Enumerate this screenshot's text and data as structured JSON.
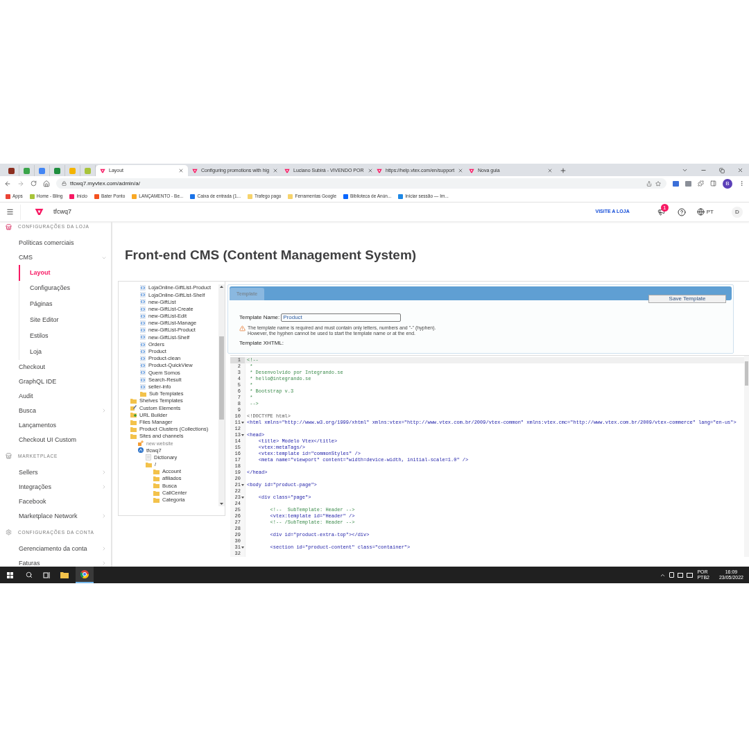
{
  "browser": {
    "pinned_tabs": [
      {
        "color": "#8b2e1f"
      },
      {
        "color": "#3aa54a"
      },
      {
        "color": "#4285f4"
      },
      {
        "color": "#1e8e3e"
      },
      {
        "color": "#f4b400"
      },
      {
        "color": "#a8c43a"
      }
    ],
    "tabs": [
      {
        "title": "Layout",
        "selected": true
      },
      {
        "title": "Configuring promotions with hig",
        "selected": false
      },
      {
        "title": "Luciano Subirá - VIVENDO POR",
        "selected": false
      },
      {
        "title": "https://help.vtex.com/en/support",
        "selected": false
      },
      {
        "title": "Nova guia",
        "selected": false
      }
    ],
    "url": "tfcwq7.myvtex.com/admin/a/",
    "profile": "B",
    "bookmarks": [
      {
        "label": "Apps",
        "color": "#ea4335"
      },
      {
        "label": "Home - Bling",
        "color": "#a8c43a"
      },
      {
        "label": "Início",
        "color": "#f71963"
      },
      {
        "label": "Bater Ponto",
        "color": "#f4511e"
      },
      {
        "label": "LANÇAMENTO - Be...",
        "color": "#f9a825"
      },
      {
        "label": "Caixa de entrada (1...",
        "color": "#1a73e8"
      },
      {
        "label": "Trafego pago",
        "color": "#f6d36b"
      },
      {
        "label": "Ferramentas Google",
        "color": "#f6d36b"
      },
      {
        "label": "Biblioteca de Anún...",
        "color": "#0866ff"
      },
      {
        "label": "Iniciar sessão — Im...",
        "color": "#1e88e5"
      }
    ]
  },
  "header": {
    "account": "tfcwq7",
    "visit_store": "VISITE A LOJA",
    "notifications": "1",
    "language": "PT",
    "avatar": "D"
  },
  "sidebar": [
    {
      "kind": "section",
      "label": "CONFIGURAÇÕES DA LOJA"
    },
    {
      "kind": "plain",
      "label": "Políticas comerciais"
    },
    {
      "kind": "expanded",
      "label": "CMS",
      "children": [
        {
          "label": "Layout",
          "selected": true
        },
        {
          "label": "Configurações",
          "selected": false
        },
        {
          "label": "Páginas",
          "selected": false
        },
        {
          "label": "Site Editor",
          "selected": false
        },
        {
          "label": "Estilos",
          "selected": false
        },
        {
          "label": "Loja",
          "selected": false
        }
      ]
    },
    {
      "kind": "plain",
      "label": "Checkout"
    },
    {
      "kind": "plain",
      "label": "GraphQL IDE"
    },
    {
      "kind": "plain",
      "label": "Audit"
    },
    {
      "kind": "collapsed",
      "label": "Busca"
    },
    {
      "kind": "plain",
      "label": "Lançamentos"
    },
    {
      "kind": "plain",
      "label": "Checkout UI Custom"
    },
    {
      "kind": "section",
      "label": "MARKETPLACE"
    },
    {
      "kind": "collapsed",
      "label": "Sellers"
    },
    {
      "kind": "collapsed",
      "label": "Integrações"
    },
    {
      "kind": "plain",
      "label": "Facebook"
    },
    {
      "kind": "collapsed",
      "label": "Marketplace Network"
    },
    {
      "kind": "section",
      "label": "CONFIGURAÇÕES DA CONTA"
    },
    {
      "kind": "collapsed",
      "label": "Gerenciamento da conta"
    },
    {
      "kind": "collapsed",
      "label": "Faturas"
    }
  ],
  "page_title": "Front-end CMS (Content Management System)",
  "tree": {
    "children_of_scrolled_folder": [
      {
        "kind": "template",
        "label": "LojaOnline-GiftList-Product"
      },
      {
        "kind": "template",
        "label": "LojaOnline-GiftList-Shelf"
      },
      {
        "kind": "template",
        "label": "new-GiftList"
      },
      {
        "kind": "template",
        "label": "new-GiftList-Create"
      },
      {
        "kind": "template",
        "label": "new-GiftList-Edit"
      },
      {
        "kind": "template",
        "label": "new-GiftList-Manage"
      },
      {
        "kind": "template",
        "label": "new-GiftList-Product"
      },
      {
        "kind": "template",
        "label": "new-GiftList-Shelf"
      },
      {
        "kind": "template",
        "label": "Orders"
      },
      {
        "kind": "template",
        "label": "Product"
      },
      {
        "kind": "template",
        "label": "Product-clean"
      },
      {
        "kind": "template",
        "label": "Product-QuickView"
      },
      {
        "kind": "template",
        "label": "Quem Somos"
      },
      {
        "kind": "template",
        "label": "Search-Result"
      },
      {
        "kind": "template",
        "label": "seller-info"
      },
      {
        "kind": "folder",
        "label": "Sub Templates"
      }
    ],
    "items": [
      {
        "kind": "folder",
        "label": "Shelves Templates"
      },
      {
        "kind": "custom",
        "label": "Custom Elements"
      },
      {
        "kind": "url",
        "label": "URL Builder"
      },
      {
        "kind": "folder",
        "label": "Files Manager"
      },
      {
        "kind": "folder",
        "label": "Product Clusters (Collections)"
      },
      {
        "kind": "folder",
        "label": "Sites and channels",
        "children": [
          {
            "kind": "new",
            "label": "new website"
          },
          {
            "kind": "site",
            "label": "tfcwq7",
            "children": [
              {
                "kind": "file",
                "label": "Dictionary"
              },
              {
                "kind": "folder",
                "label": "/",
                "children": [
                  {
                    "kind": "folder",
                    "label": "Account"
                  },
                  {
                    "kind": "folder",
                    "label": "afiliados"
                  },
                  {
                    "kind": "folder",
                    "label": "Busca"
                  },
                  {
                    "kind": "folder",
                    "label": "CallCenter"
                  },
                  {
                    "kind": "folder",
                    "label": "Categoria"
                  }
                ]
              }
            ]
          }
        ]
      }
    ]
  },
  "template": {
    "tab": "Template",
    "save_button": "Save Template",
    "name_label": "Template Name:",
    "name_value": "Product",
    "warning": [
      "The template name is required and must contain only letters, numbers and \"-\" (hyphen).",
      "However, the hyphen cannot be used to start the template name or at the end."
    ],
    "xhtml_label": "Template XHTML:"
  },
  "code_lines": [
    {
      "number": "1",
      "kind": "comment",
      "text": "<!--",
      "foldable": false
    },
    {
      "number": "2",
      "kind": "comment",
      "text": " *",
      "foldable": false
    },
    {
      "number": "3",
      "kind": "comment",
      "text": " * Desenvolvido por Integrando.se",
      "foldable": false
    },
    {
      "number": "4",
      "kind": "comment",
      "text": " * hello@integrando.se",
      "foldable": false
    },
    {
      "number": "5",
      "kind": "comment",
      "text": " *",
      "foldable": false
    },
    {
      "number": "6",
      "kind": "comment",
      "text": " * Bootstrap v.3",
      "foldable": false
    },
    {
      "number": "7",
      "kind": "comment",
      "text": " *",
      "foldable": false
    },
    {
      "number": "8",
      "kind": "comment",
      "text": " -->",
      "foldable": false
    },
    {
      "number": "9",
      "foldable": false
    },
    {
      "number": "10",
      "kind": "doctype",
      "text": "<!DOCTYPE html>",
      "foldable": false
    },
    {
      "number": "11",
      "kind": "code",
      "text": "<html xmlns=\"http://www.w3.org/1999/xhtml\" xmlns:vtex=\"http://www.vtex.com.br/2009/vtex-common\" xmlns:vtex.cmc=\"http://www.vtex.com.br/2009/vtex-commerce\" lang=\"en-us\">",
      "foldable": true
    },
    {
      "number": "12",
      "foldable": false
    },
    {
      "number": "13",
      "kind": "code",
      "text": "<head>",
      "foldable": true
    },
    {
      "number": "14",
      "kind": "code",
      "text": "    <title> Modelo Vtex</title>",
      "foldable": false
    },
    {
      "number": "15",
      "kind": "code",
      "text": "    <vtex:metaTags/>",
      "foldable": false
    },
    {
      "number": "16",
      "kind": "code",
      "text": "    <vtex:template id=\"commonStyles\" />",
      "foldable": false
    },
    {
      "number": "17",
      "kind": "code",
      "text": "    <meta name=\"viewport\" content=\"width=device-width, initial-scale=1.0\" />",
      "foldable": false
    },
    {
      "number": "18",
      "foldable": false
    },
    {
      "number": "19",
      "kind": "code",
      "text": "</head>",
      "foldable": false
    },
    {
      "number": "20",
      "foldable": false
    },
    {
      "number": "21",
      "kind": "code",
      "text": "<body id=\"product-page\">",
      "foldable": true
    },
    {
      "number": "22",
      "foldable": false
    },
    {
      "number": "23",
      "kind": "code",
      "text": "    <div class=\"page\">",
      "foldable": true
    },
    {
      "number": "24",
      "foldable": false
    },
    {
      "number": "25",
      "kind": "comment",
      "text": "        <!--  SubTemplate: Header -->",
      "foldable": false
    },
    {
      "number": "26",
      "kind": "code",
      "text": "        <vtex:template id=\"Header\" />",
      "foldable": false
    },
    {
      "number": "27",
      "kind": "comment",
      "text": "        <!-- /SubTemplate: Header -->",
      "foldable": false
    },
    {
      "number": "28",
      "foldable": false
    },
    {
      "number": "29",
      "kind": "code",
      "text": "        <div id=\"product-extra-top\"></div>",
      "foldable": false
    },
    {
      "number": "30",
      "foldable": false
    },
    {
      "number": "31",
      "kind": "code",
      "text": "        <section id=\"product-content\" class=\"container\">",
      "foldable": true
    },
    {
      "number": "32",
      "foldable": false
    }
  ],
  "taskbar": {
    "input_language": "POR",
    "keyboard": "PTB2",
    "time": "16:09",
    "date": "23/05/2022"
  }
}
